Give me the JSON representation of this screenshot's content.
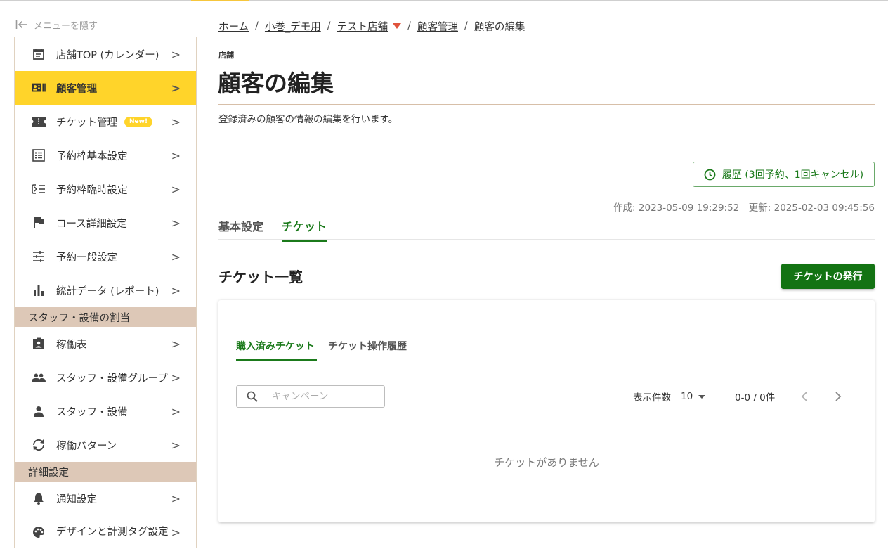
{
  "sidebar": {
    "hide_menu_label": "メニューを隠す",
    "items": [
      {
        "label": "店舗TOP (カレンダー)",
        "icon": "calendar-icon"
      },
      {
        "label": "顧客管理",
        "icon": "contact-card-icon",
        "active": true
      },
      {
        "label": "チケット管理",
        "icon": "ticket-icon",
        "badge": "New!"
      },
      {
        "label": "予約枠基本設定",
        "icon": "list-icon"
      },
      {
        "label": "予約枠臨時設定",
        "icon": "temp-list-icon"
      },
      {
        "label": "コース詳細設定",
        "icon": "flag-icon"
      },
      {
        "label": "予約一般設定",
        "icon": "sliders-icon"
      },
      {
        "label": "統計データ (レポート)",
        "icon": "bar-chart-icon"
      }
    ],
    "section_staff": "スタッフ・設備の割当",
    "staff_items": [
      {
        "label": "稼働表",
        "icon": "assignment-icon"
      },
      {
        "label": "スタッフ・設備グループ",
        "icon": "people-icon"
      },
      {
        "label": "スタッフ・設備",
        "icon": "person-icon"
      },
      {
        "label": "稼働パターン",
        "icon": "sync-icon"
      }
    ],
    "section_detail": "詳細設定",
    "detail_items": [
      {
        "label": "通知設定",
        "icon": "bell-icon"
      },
      {
        "label_line1": "デザインと",
        "label_line2": "計測タグ設定",
        "icon": "palette-icon"
      }
    ],
    "chevron": ">"
  },
  "breadcrumb": {
    "home": "ホーム",
    "org": "小巻_デモ用",
    "shop": "テスト店舗",
    "customers": "顧客管理",
    "current": "顧客の編集",
    "sep": "/"
  },
  "page": {
    "kicker": "店舗",
    "title": "顧客の編集",
    "description": "登録済みの顧客の情報の編集を行います。",
    "history_button": "履歴 (3回予約、1回キャンセル)",
    "timestamps": "作成: 2023-05-09 19:29:52　更新: 2025-02-03 09:45:56"
  },
  "tabs": {
    "basic": "基本設定",
    "ticket": "チケット"
  },
  "ticket_list": {
    "title": "チケット一覧",
    "issue_button": "チケットの発行",
    "subtab_purchased": "購入済みチケット",
    "subtab_history": "チケット操作履歴",
    "search_placeholder": "キャンペーン",
    "per_page_label": "表示件数",
    "per_page_value": "10",
    "range": "0-0 / 0件",
    "empty_message": "チケットがありません"
  },
  "colors": {
    "accent_yellow": "#ffd42a",
    "primary_green": "#137313",
    "section_beige": "#ddc8b7"
  }
}
